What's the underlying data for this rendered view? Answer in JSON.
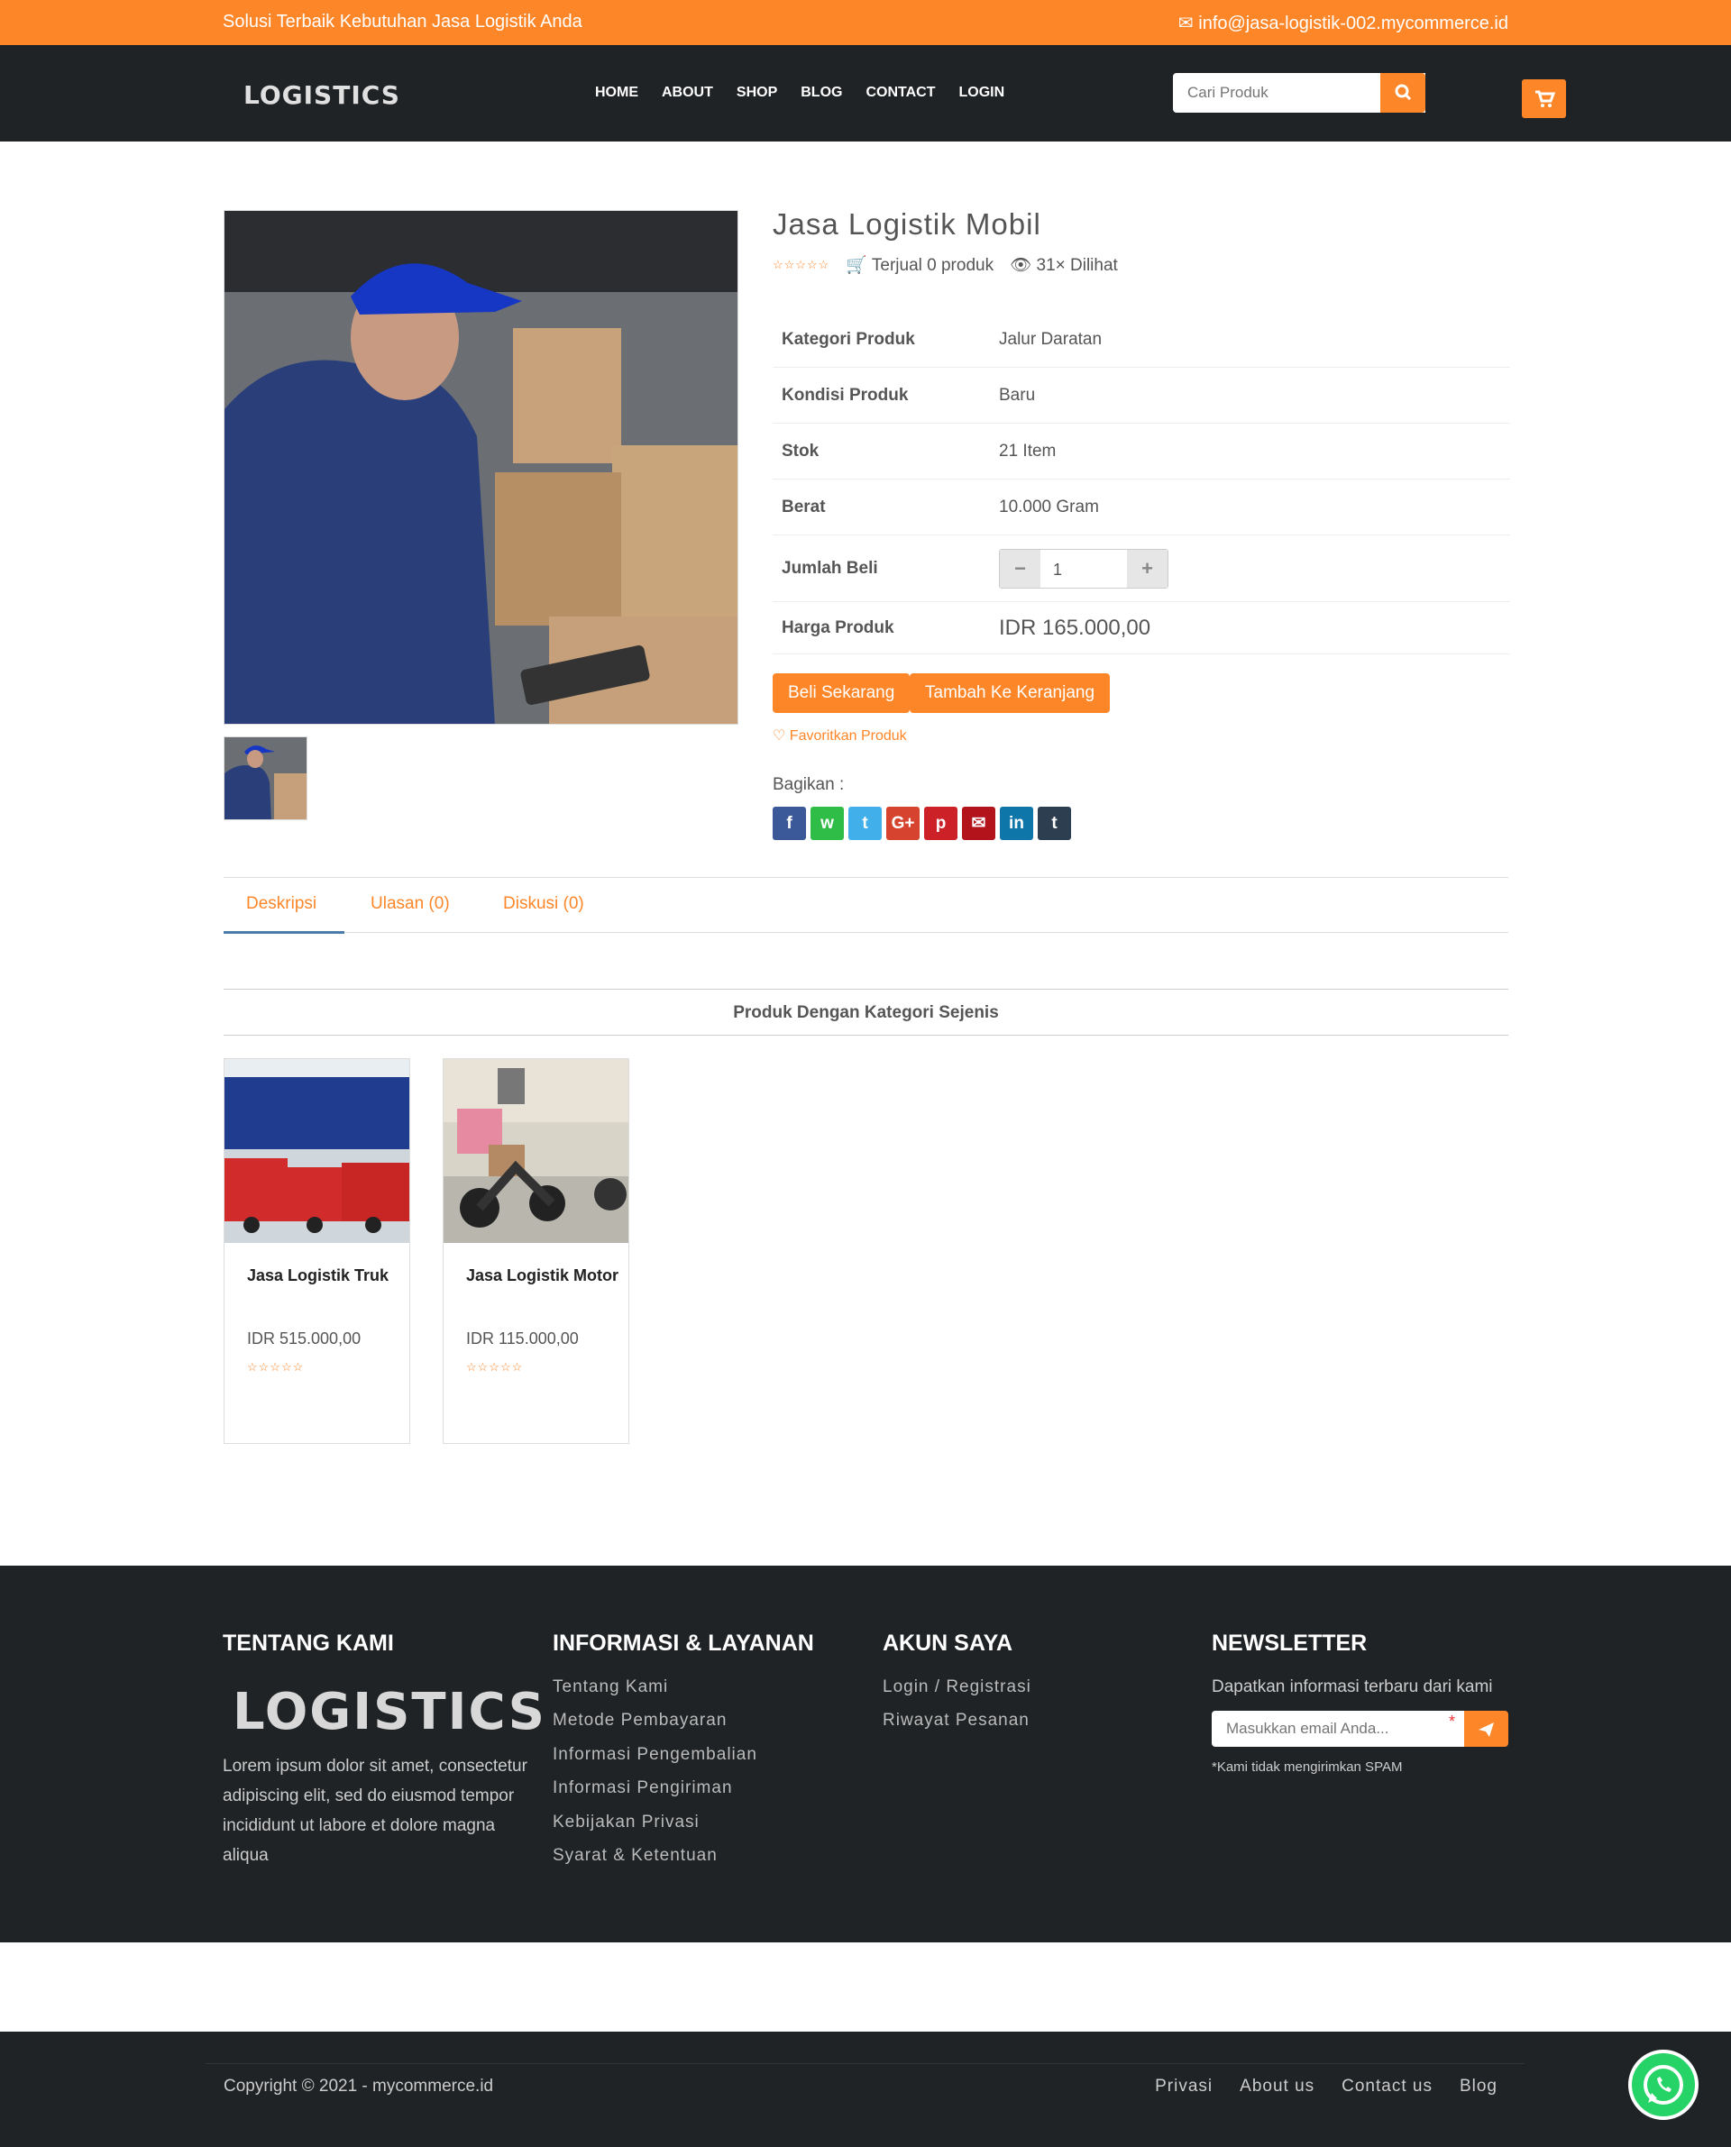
{
  "topbar": {
    "tagline": "Solusi Terbaik Kebutuhan Jasa Logistik Anda",
    "email": "info@jasa-logistik-002.mycommerce.id"
  },
  "nav": {
    "logo": "LOGISTICS",
    "menu": [
      "HOME",
      "ABOUT",
      "SHOP",
      "BLOG",
      "CONTACT",
      "LOGIN"
    ],
    "search_placeholder": "Cari Produk"
  },
  "product": {
    "title": "Jasa Logistik Mobil",
    "rating_stars": "☆☆☆☆☆",
    "sold": "Terjual 0 produk",
    "views": "31× Dilihat",
    "specs": [
      {
        "k": "Kategori Produk",
        "v": "Jalur Daratan"
      },
      {
        "k": "Kondisi Produk",
        "v": "Baru"
      },
      {
        "k": "Stok",
        "v": "21 Item"
      },
      {
        "k": "Berat",
        "v": "10.000 Gram"
      }
    ],
    "qty_label": "Jumlah Beli",
    "qty": "1",
    "price_label": "Harga Produk",
    "price": "IDR 165.000,00",
    "buy": "Beli Sekarang",
    "add_cart": "Tambah Ke Keranjang",
    "favorite": "Favoritkan Produk",
    "share_label": "Bagikan :"
  },
  "share_buttons": [
    {
      "icon": "f",
      "name": "facebook",
      "color": "#3b5998"
    },
    {
      "icon": "w",
      "name": "whatsapp",
      "color": "#2fbd48"
    },
    {
      "icon": "t",
      "name": "twitter",
      "color": "#41b0ea"
    },
    {
      "icon": "G+",
      "name": "google-plus",
      "color": "#d6432f"
    },
    {
      "icon": "p",
      "name": "pinterest",
      "color": "#cc2127"
    },
    {
      "icon": "✉",
      "name": "email",
      "color": "#b3141c"
    },
    {
      "icon": "in",
      "name": "linkedin",
      "color": "#0e76a8"
    },
    {
      "icon": "t",
      "name": "tumblr",
      "color": "#2c3e50"
    }
  ],
  "tabs": [
    "Deskripsi",
    "Ulasan (0)",
    "Diskusi (0)"
  ],
  "similar": {
    "heading": "Produk Dengan Kategori Sejenis",
    "items": [
      {
        "name": "Jasa Logistik Truk",
        "price": "IDR 515.000,00",
        "stars": "☆☆☆☆☆"
      },
      {
        "name": "Jasa Logistik Motor",
        "price": "IDR 115.000,00",
        "stars": "☆☆☆☆☆"
      }
    ]
  },
  "footer": {
    "about_h": "TENTANG KAMI",
    "logo": "LOGISTICS",
    "about_text": "Lorem ipsum dolor sit amet, consectetur adipiscing elit, sed do eiusmod tempor incididunt ut labore et dolore magna aliqua",
    "info_h": "INFORMASI & LAYANAN",
    "info_links": [
      "Tentang Kami",
      "Metode Pembayaran",
      "Informasi Pengembalian",
      "Informasi Pengiriman",
      "Kebijakan Privasi",
      "Syarat & Ketentuan"
    ],
    "acc_h": "AKUN SAYA",
    "acc_links": [
      "Login / Registrasi",
      "Riwayat Pesanan"
    ],
    "nl_h": "NEWSLETTER",
    "nl_text": "Dapatkan informasi terbaru dari kami",
    "nl_placeholder": "Masukkan email Anda...",
    "nl_req": "*",
    "nl_note": "*Kami tidak mengirimkan SPAM"
  },
  "bottom": {
    "copyright": "Copyright © 2021 - mycommerce.id",
    "links": [
      "Privasi",
      "About us",
      "Contact us",
      "Blog"
    ]
  },
  "colors": {
    "accent": "#fd8629",
    "dark": "#202325"
  }
}
